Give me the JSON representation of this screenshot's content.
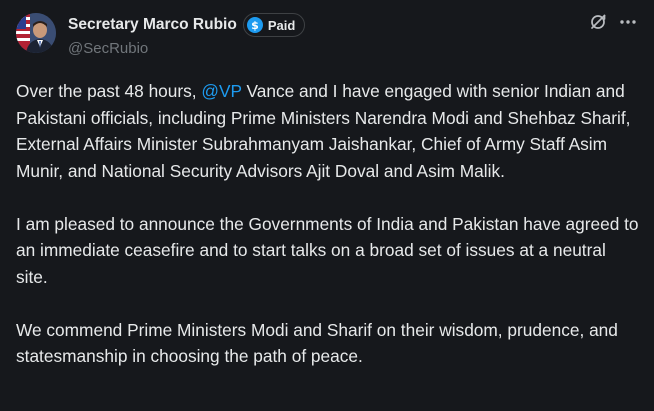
{
  "author": {
    "display_name": "Secretary Marco Rubio",
    "handle": "@SecRubio",
    "badge_label": "Paid",
    "badge_icon": "dollar-coin-icon",
    "badge_color": "#1d9bf0",
    "avatar_icon": "profile-photo-with-flag"
  },
  "actions": {
    "grok_icon": "grok-icon",
    "more_icon": "more-horizontal-icon"
  },
  "post": {
    "para1": {
      "before": "Over the past 48 hours, ",
      "mention": "@VP",
      "after": " Vance and I have engaged with senior Indian and Pakistani officials, including Prime Ministers Narendra Modi and Shehbaz Sharif, External Affairs Minister Subrahmanyam Jaishankar, Chief of Army Staff Asim Munir, and National Security Advisors Ajit Doval and Asim Malik."
    },
    "para2": "I am pleased to announce the Governments of India and Pakistan have agreed to an immediate ceasefire and to start talks on a broad set of issues at a neutral site.",
    "para3": "We commend Prime Ministers Modi and Sharif on their wisdom, prudence, and statesmanship in choosing the path of peace."
  },
  "colors": {
    "background": "#16181c",
    "text": "#e7e9ea",
    "muted": "#71767b",
    "link": "#1d9bf0"
  }
}
